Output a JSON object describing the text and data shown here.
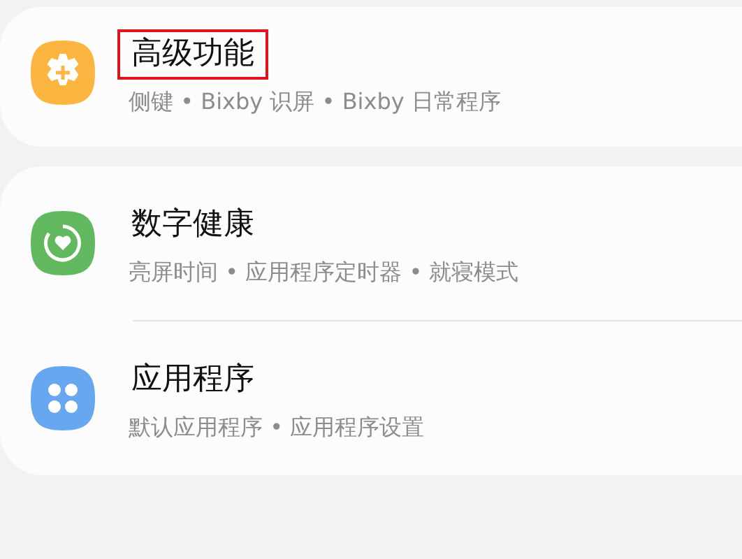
{
  "cards": [
    {
      "items": [
        {
          "kind": "gear",
          "color": "#fbb540",
          "title": "高级功能",
          "subtitle": "侧键 • Bixby 识屏 • Bixby 日常程序",
          "highlighted": true
        }
      ]
    },
    {
      "items": [
        {
          "kind": "heart",
          "color": "#62b85f",
          "title": "数字健康",
          "subtitle": "亮屏时间 • 应用程序定时器 • 就寝模式",
          "highlighted": false
        },
        {
          "kind": "apps",
          "color": "#66a7f0",
          "title": "应用程序",
          "subtitle": "默认应用程序 • 应用程序设置",
          "highlighted": false
        }
      ]
    }
  ]
}
